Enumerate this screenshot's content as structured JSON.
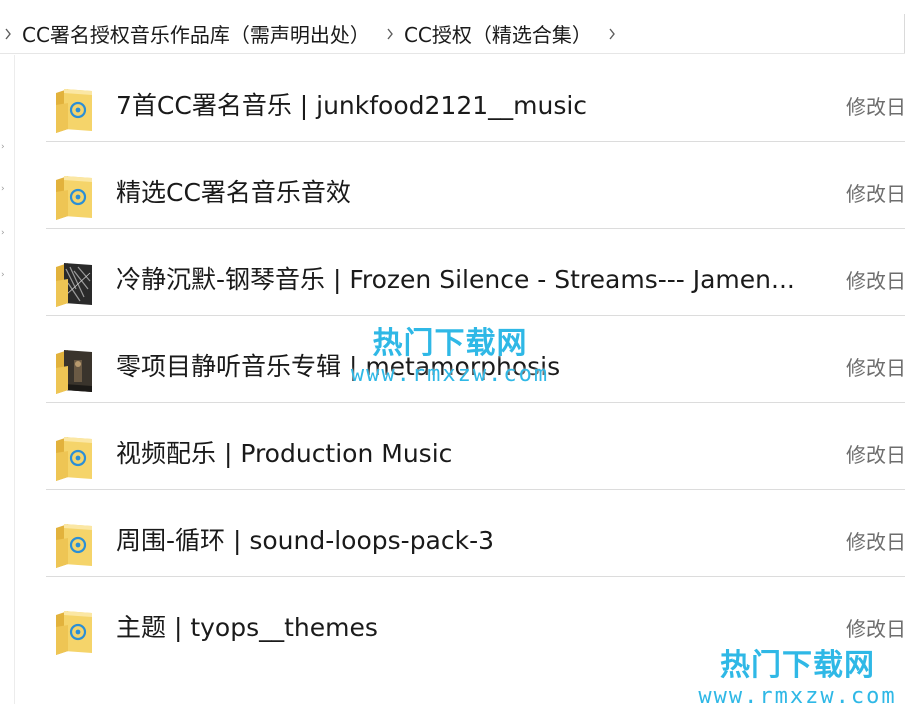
{
  "breadcrumb": {
    "items": [
      {
        "label": "CC署名授权音乐作品库（需声明出处）"
      },
      {
        "label": "CC授权（精选合集）"
      }
    ]
  },
  "file_list": {
    "column_date_label": "修改日",
    "items": [
      {
        "name": "7首CC署名音乐 | junkfood2121__music",
        "icon": "folder-music-icon"
      },
      {
        "name": "精选CC署名音乐音效",
        "icon": "folder-music-icon"
      },
      {
        "name": "冷静沉默-钢琴音乐 | Frozen Silence - Streams--- Jamen...",
        "icon": "folder-album-art-icon"
      },
      {
        "name": "零项目静听音乐专辑 | metamorphosis",
        "icon": "folder-album-art-icon"
      },
      {
        "name": "视频配乐 | Production Music",
        "icon": "folder-music-icon"
      },
      {
        "name": "周围-循环 | sound-loops-pack-3",
        "icon": "folder-music-icon"
      },
      {
        "name": "主题 | tyops__themes",
        "icon": "folder-music-icon"
      }
    ]
  },
  "watermark": {
    "title": "热门下载网",
    "url": "www.rmxzw.com"
  },
  "colors": {
    "folder_yellow": "#f5d46a",
    "folder_dark": "#e2b23c",
    "music_blue": "#2b8fd6",
    "watermark_blue": "#2fb8e6"
  }
}
